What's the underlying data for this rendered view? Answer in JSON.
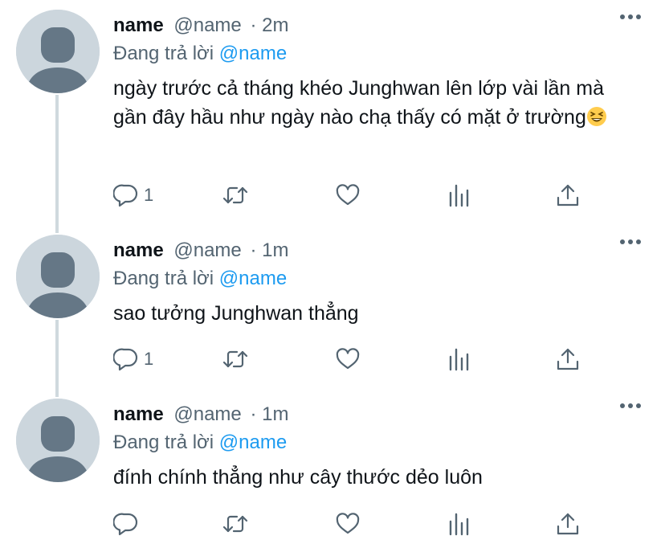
{
  "tweets": [
    {
      "name": "name",
      "handle": "@name",
      "time": "· 2m",
      "replying_prefix": "Đang trả lời",
      "replying_to": "@name",
      "text": "ngày trước cả tháng khéo Junghwan lên lớp vài lần mà gần đây hầu như ngày nào chạ thấy có mặt ở trường",
      "emoji": "grinning-squinting-face",
      "reply_count": "1"
    },
    {
      "name": "name",
      "handle": "@name",
      "time": "· 1m",
      "replying_prefix": "Đang trả lời",
      "replying_to": "@name",
      "text": "sao tưởng Junghwan thẳng",
      "reply_count": "1"
    },
    {
      "name": "name",
      "handle": "@name",
      "time": "· 1m",
      "replying_prefix": "Đang trả lời",
      "replying_to": "@name",
      "text": "đính chính thẳng như cây thước dẻo luôn",
      "reply_count": ""
    }
  ],
  "icons": {
    "reply": "reply-icon",
    "retweet": "retweet-icon",
    "like": "heart-icon",
    "views": "analytics-icon",
    "share": "share-icon",
    "more": "more-icon"
  },
  "colors": {
    "mention": "#1d9bf0",
    "secondary_text": "#536471",
    "avatar_bg": "#ccd6dd",
    "avatar_figure": "#657786",
    "thread_line": "#cfd9de"
  }
}
